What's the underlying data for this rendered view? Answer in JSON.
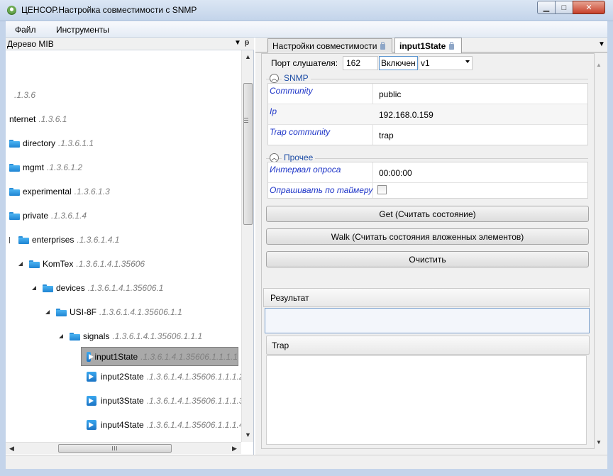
{
  "window": {
    "title": "ЦЕНСОР.Настройка совместимости с SNMP"
  },
  "menu": {
    "items": [
      "Файл",
      "Инструменты"
    ]
  },
  "left_panel": {
    "title": "Дерево MIB"
  },
  "tree": {
    "rows": [
      {
        "name": "",
        "oid": ".1.3.6"
      },
      {
        "name": "nternet",
        "oid": ".1.3.6.1"
      },
      {
        "name": "directory",
        "oid": ".1.3.6.1.1"
      },
      {
        "name": "mgmt",
        "oid": ".1.3.6.1.2"
      },
      {
        "name": "experimental",
        "oid": ".1.3.6.1.3"
      },
      {
        "name": "private",
        "oid": ".1.3.6.1.4"
      },
      {
        "name": "enterprises",
        "oid": ".1.3.6.1.4.1"
      },
      {
        "name": "KomTex",
        "oid": ".1.3.6.1.4.1.35606"
      },
      {
        "name": "devices",
        "oid": ".1.3.6.1.4.1.35606.1"
      },
      {
        "name": "USI-8F",
        "oid": ".1.3.6.1.4.1.35606.1.1"
      },
      {
        "name": "signals",
        "oid": ".1.3.6.1.4.1.35606.1.1.1"
      },
      {
        "name": "input1State",
        "oid": ".1.3.6.1.4.1.35606.1.1.1.1"
      },
      {
        "name": "input2State",
        "oid": ".1.3.6.1.4.1.35606.1.1.1.2"
      },
      {
        "name": "input3State",
        "oid": ".1.3.6.1.4.1.35606.1.1.1.3"
      },
      {
        "name": "input4State",
        "oid": ".1.3.6.1.4.1.35606.1.1.1.4"
      }
    ]
  },
  "tabs": [
    {
      "label": "Настройки совместимости"
    },
    {
      "label": "input1State"
    }
  ],
  "listener": {
    "label": "Порт слушателя:",
    "port": "162",
    "state": "Включен",
    "version": "v1"
  },
  "snmp_group": {
    "title": "SNMP",
    "rows": [
      {
        "name": "Community",
        "value": "public"
      },
      {
        "name": "Ip",
        "value": "192.168.0.159"
      },
      {
        "name": "Trap community",
        "value": "trap"
      }
    ]
  },
  "other_group": {
    "title": "Прочее",
    "interval_name": "Интервал опроса",
    "interval_value": "00:00:00",
    "timer_name": "Опрашивать по таймеру"
  },
  "buttons": {
    "get": "Get (Считать состояние)",
    "walk": "Walk (Считать состояния вложенных элементов)",
    "clear": "Очистить"
  },
  "result": {
    "title": "Результат"
  },
  "trap": {
    "title": "Trap"
  },
  "colors": {
    "accent": "#1f36c8",
    "group_title": "#1f4ea6",
    "selection": "#a9a9a9"
  }
}
